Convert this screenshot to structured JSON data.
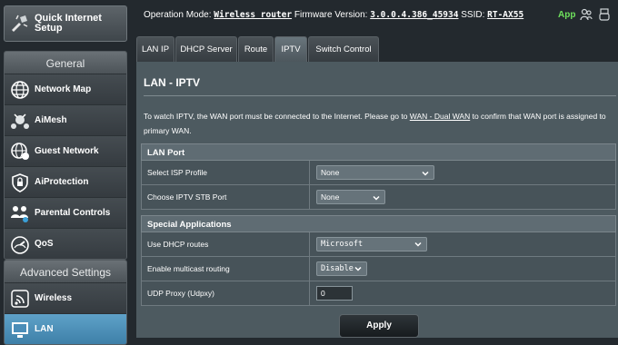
{
  "sidebar": {
    "quick_setup": "Quick Internet Setup",
    "general_title": "General",
    "general_items": [
      {
        "label": "Network Map",
        "icon": "globe-icon"
      },
      {
        "label": "AiMesh",
        "icon": "aimesh-icon"
      },
      {
        "label": "Guest Network",
        "icon": "guest-network-icon"
      },
      {
        "label": "AiProtection",
        "icon": "lock-shield-icon"
      },
      {
        "label": "Parental Controls",
        "icon": "family-icon"
      },
      {
        "label": "QoS",
        "icon": "gauge-icon"
      }
    ],
    "advanced_title": "Advanced Settings",
    "advanced_items": [
      {
        "label": "Wireless",
        "icon": "wifi-icon"
      },
      {
        "label": "LAN",
        "icon": "monitor-icon"
      }
    ]
  },
  "topbar": {
    "mode_label": "Operation Mode:",
    "mode_value": "Wireless router",
    "firmware_label": "Firmware Version:",
    "firmware_value": "3.0.0.4.386_45934",
    "ssid_label": "SSID:",
    "ssid_value": "RT-AX55",
    "app_link": "App"
  },
  "tabs": [
    "LAN IP",
    "DHCP Server",
    "Route",
    "IPTV",
    "Switch Control"
  ],
  "page": {
    "title": "LAN - IPTV",
    "desc_part1": "To watch IPTV, the WAN port must be connected to the Internet. Please go to ",
    "desc_link": "WAN - Dual WAN",
    "desc_part2": " to confirm that WAN port is assigned to primary WAN.",
    "lan_port_header": "LAN Port",
    "isp_profile_label": "Select ISP Profile",
    "isp_profile_value": "None",
    "stb_port_label": "Choose IPTV STB Port",
    "stb_port_value": "None",
    "special_header": "Special Applications",
    "dhcp_routes_label": "Use DHCP routes",
    "dhcp_routes_value": "Microsoft",
    "multicast_label": "Enable multicast routing",
    "multicast_value": "Disable",
    "udpxy_label": "UDP Proxy (Udpxy)",
    "udpxy_value": "0",
    "apply_label": "Apply"
  },
  "colors": {
    "active_nav": "#4a8db8",
    "app_link": "#6fe15d",
    "panel": "#4d5a60"
  }
}
